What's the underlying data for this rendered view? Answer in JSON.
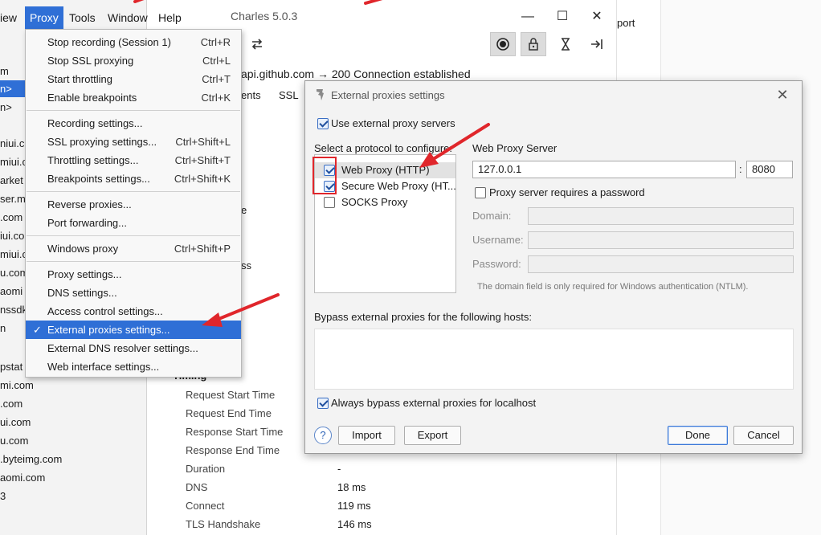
{
  "app": {
    "title": "Charles 5.0.3",
    "menubar": [
      "iew",
      "Proxy",
      "Tools",
      "Window",
      "Help"
    ],
    "window_controls": [
      "—",
      "☐",
      "✕"
    ]
  },
  "toolbar": {
    "icons": [
      "repeat-icon",
      "record-icon",
      "lock-icon",
      "hourglass-icon",
      "arrow-to-right-icon"
    ]
  },
  "sidebar": {
    "items": [
      "m",
      "n>",
      "n>",
      "",
      "niui.co",
      "miui.c",
      "arket",
      "ser.m",
      ".com",
      "iui.co",
      "miui.c",
      "u.com",
      "aomi",
      "nssdk",
      "n",
      "",
      "pstat",
      "mi.com",
      ".com",
      "ui.com",
      "u.com",
      ".byteimg.com",
      "aomi.com",
      "3"
    ]
  },
  "main": {
    "connection": "api.github.com → 200 Connection established",
    "tabs": [
      "ents",
      "SSL"
    ],
    "frag_e": "e",
    "frag_ss": "ss",
    "timing_header": "Timing",
    "timing_rows": [
      {
        "label": "Request Start Time",
        "value": ""
      },
      {
        "label": "Request End Time",
        "value": ""
      },
      {
        "label": "Response Start Time",
        "value": ""
      },
      {
        "label": "Response End Time",
        "value": ""
      },
      {
        "label": "Duration",
        "value": "-"
      },
      {
        "label": "DNS",
        "value": "18 ms"
      },
      {
        "label": "Connect",
        "value": "119 ms"
      },
      {
        "label": "TLS Handshake",
        "value": "146 ms"
      }
    ],
    "right_strip_text": "port"
  },
  "proxy_menu": {
    "groups": [
      [
        {
          "label": "Stop recording (Session 1)",
          "shortcut": "Ctrl+R"
        },
        {
          "label": "Stop SSL proxying",
          "shortcut": "Ctrl+L"
        },
        {
          "label": "Start throttling",
          "shortcut": "Ctrl+T"
        },
        {
          "label": "Enable breakpoints",
          "shortcut": "Ctrl+K"
        }
      ],
      [
        {
          "label": "Recording settings...",
          "shortcut": ""
        },
        {
          "label": "SSL proxying settings...",
          "shortcut": "Ctrl+Shift+L"
        },
        {
          "label": "Throttling settings...",
          "shortcut": "Ctrl+Shift+T"
        },
        {
          "label": "Breakpoints settings...",
          "shortcut": "Ctrl+Shift+K"
        }
      ],
      [
        {
          "label": "Reverse proxies...",
          "shortcut": ""
        },
        {
          "label": "Port forwarding...",
          "shortcut": ""
        }
      ],
      [
        {
          "label": "Windows proxy",
          "shortcut": "Ctrl+Shift+P"
        }
      ],
      [
        {
          "label": "Proxy settings...",
          "shortcut": ""
        },
        {
          "label": "DNS settings...",
          "shortcut": ""
        },
        {
          "label": "Access control settings...",
          "shortcut": ""
        },
        {
          "label": "External proxies settings...",
          "shortcut": "",
          "checked": true,
          "selected": true
        },
        {
          "label": "External DNS resolver settings...",
          "shortcut": ""
        },
        {
          "label": "Web interface settings...",
          "shortcut": ""
        }
      ]
    ]
  },
  "dialog": {
    "title": "External proxies settings",
    "use_external_label": "Use external proxy servers",
    "use_external_checked": true,
    "protocol_prompt": "Select a protocol to configure:",
    "protocols": [
      {
        "label": "Web Proxy (HTTP)",
        "checked": true,
        "selected": true
      },
      {
        "label": "Secure Web Proxy (HT...",
        "checked": true,
        "selected": false
      },
      {
        "label": "SOCKS Proxy",
        "checked": false,
        "selected": false
      }
    ],
    "server_heading": "Web Proxy Server",
    "host": "127.0.0.1",
    "port_sep": ":",
    "port": "8080",
    "requires_password_label": "Proxy server requires a password",
    "requires_password_checked": false,
    "domain_label": "Domain:",
    "username_label": "Username:",
    "password_label": "Password:",
    "hint": "The domain field is only required for Windows authentication (NTLM).",
    "bypass_label": "Bypass external proxies for the following hosts:",
    "bypass_hosts": "",
    "always_bypass_label": "Always bypass external proxies for localhost",
    "always_bypass_checked": true,
    "help_symbol": "?",
    "buttons": {
      "import": "Import",
      "export": "Export",
      "done": "Done",
      "cancel": "Cancel"
    }
  },
  "annotation_color": "#e0262b"
}
